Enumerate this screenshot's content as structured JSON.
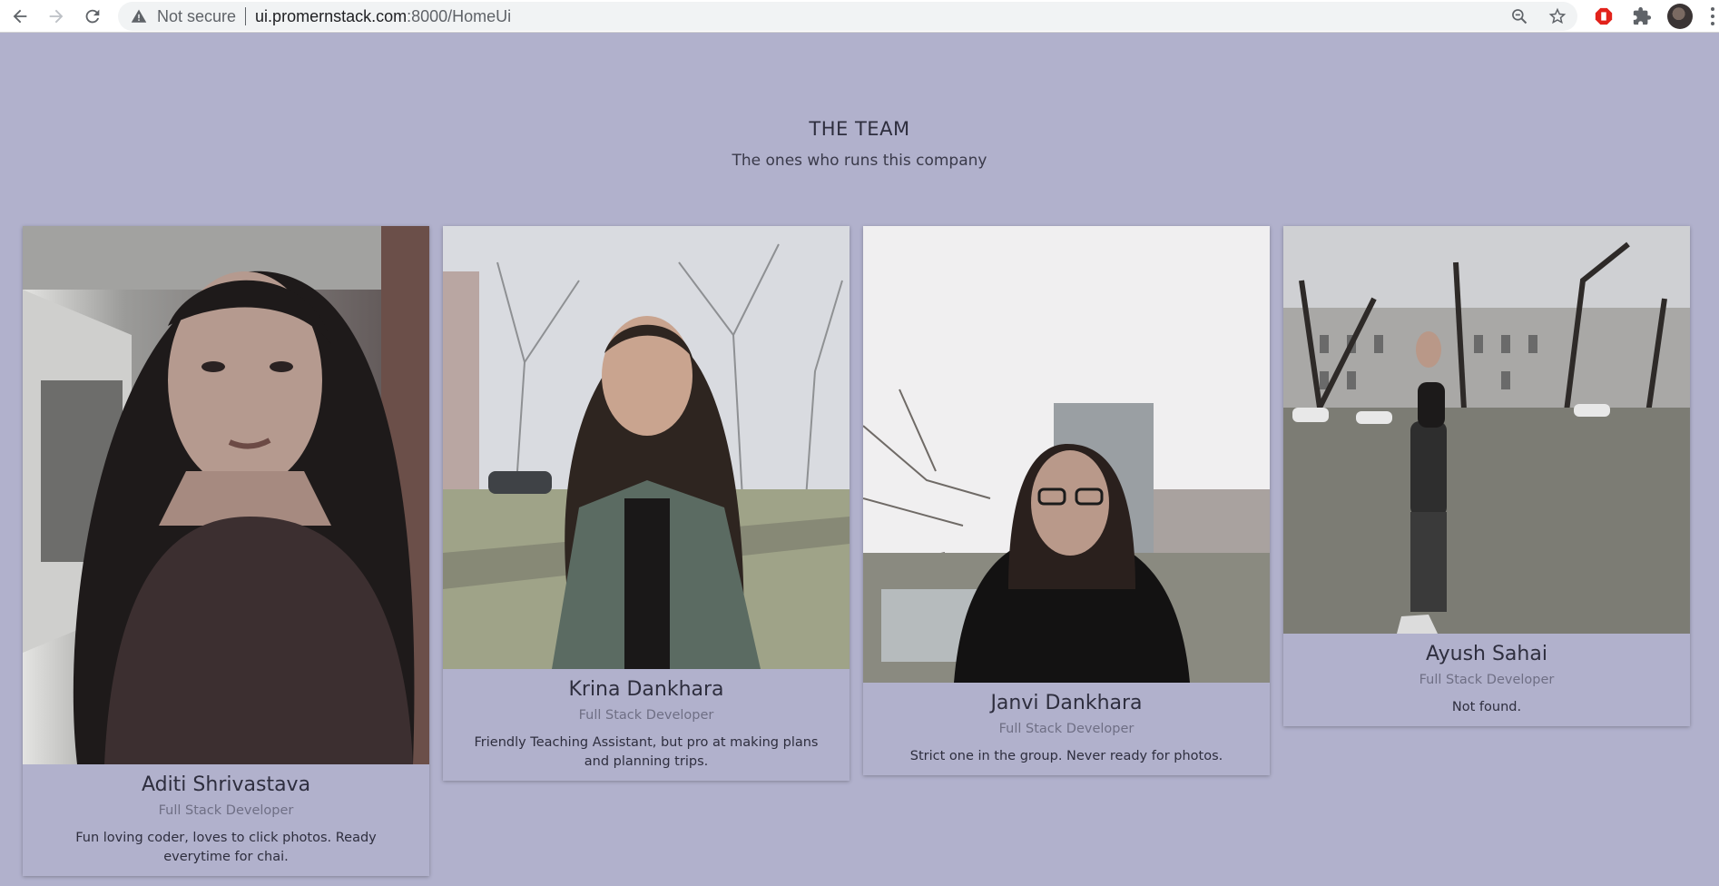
{
  "browser": {
    "security_label": "Not secure",
    "url_host": "ui.promernstack.com",
    "url_rest": ":8000/HomeUi"
  },
  "page": {
    "title": "THE TEAM",
    "subtitle": "The ones who runs this company"
  },
  "team": [
    {
      "name": "Aditi Shrivastava",
      "role": "Full Stack Developer",
      "description": "Fun loving coder, loves to click photos. Ready everytime for chai."
    },
    {
      "name": "Krina Dankhara",
      "role": "Full Stack Developer",
      "description": "Friendly Teaching Assistant, but pro at making plans and planning trips."
    },
    {
      "name": "Janvi Dankhara",
      "role": "Full Stack Developer",
      "description": "Strict one in the group. Never ready for photos."
    },
    {
      "name": "Ayush Sahai",
      "role": "Full Stack Developer",
      "description": "Not found."
    }
  ],
  "colors": {
    "page_background": "#b1b1cc",
    "text_primary": "#2e2e3e",
    "text_muted": "#6f6f85"
  }
}
